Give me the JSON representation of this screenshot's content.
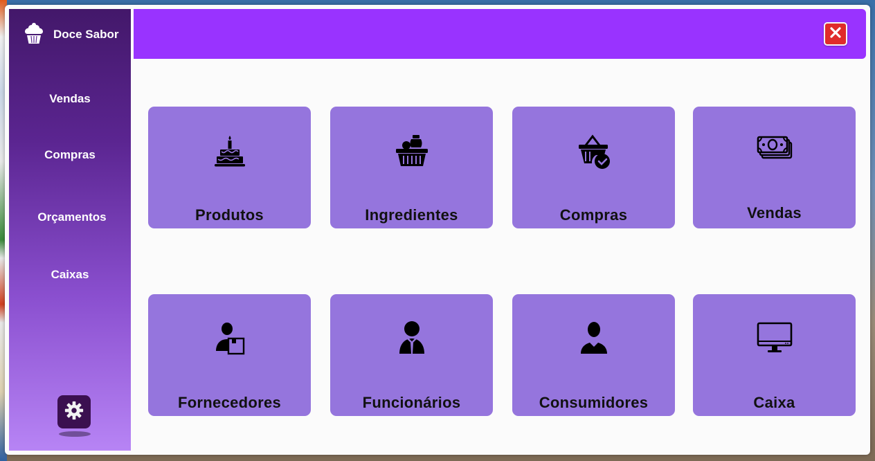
{
  "app": {
    "brand_name": "Doce Sabor",
    "brand_icon": "cupcake-icon"
  },
  "sidebar": {
    "items": [
      {
        "label": "Vendas"
      },
      {
        "label": "Compras"
      },
      {
        "label": "Orçamentos"
      },
      {
        "label": "Caixas"
      }
    ],
    "settings_icon": "gear-icon"
  },
  "header": {
    "close_icon": "close-icon"
  },
  "tiles": [
    {
      "label": "Produtos",
      "icon": "cake-icon"
    },
    {
      "label": "Ingredientes",
      "icon": "grocery-basket-icon"
    },
    {
      "label": "Compras",
      "icon": "basket-check-icon"
    },
    {
      "label": "Vendas",
      "icon": "money-stack-icon"
    },
    {
      "label": "Fornecedores",
      "icon": "supplier-icon"
    },
    {
      "label": "Funcionários",
      "icon": "employee-icon"
    },
    {
      "label": "Consumidores",
      "icon": "customer-icon"
    },
    {
      "label": "Caixa",
      "icon": "monitor-icon"
    }
  ],
  "colors": {
    "topbar": "#9933ff",
    "tile": "#9575dd",
    "close": "#e02b2b"
  }
}
